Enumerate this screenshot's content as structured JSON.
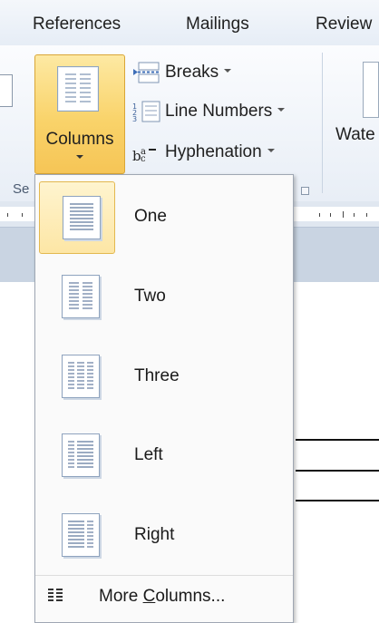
{
  "tabs": [
    "References",
    "Mailings",
    "Review"
  ],
  "page_setup": {
    "columns_label": "Columns",
    "breaks_label": "Breaks",
    "line_numbers_label": "Line Numbers",
    "hyphenation_label": "Hyphenation",
    "group_label": "Se",
    "watermark_label": "Wate"
  },
  "columns_menu": {
    "items": [
      {
        "label": "One",
        "selected": true
      },
      {
        "label": "Two",
        "selected": false
      },
      {
        "label": "Three",
        "selected": false
      },
      {
        "label": "Left",
        "selected": false
      },
      {
        "label": "Right",
        "selected": false
      }
    ],
    "more_prefix": "More ",
    "more_accel": "C",
    "more_suffix": "olumns..."
  },
  "colors": {
    "selection_fill": "#fde6a5",
    "selection_border": "#e3b84f",
    "ribbon_bg": "#e8eef6",
    "icon_border": "#8ea3be"
  },
  "icons": [
    "columns-icon",
    "breaks-icon",
    "line-numbers-icon",
    "hyphenation-icon",
    "watermark-icon",
    "dialog-launcher-icon",
    "more-columns-icon"
  ]
}
